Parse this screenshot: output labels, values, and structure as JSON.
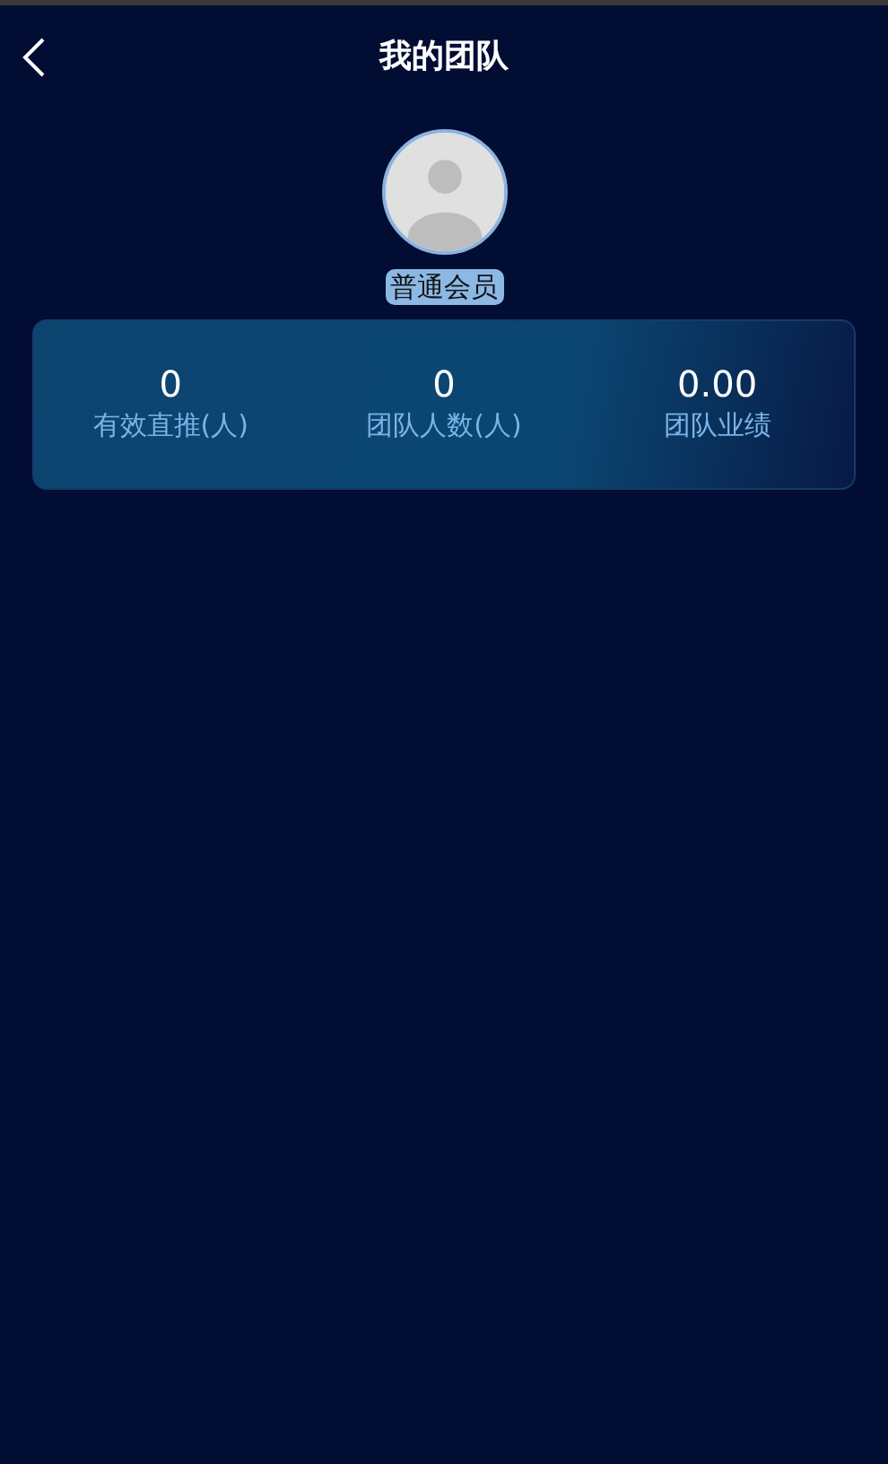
{
  "header": {
    "title": "我的团队"
  },
  "profile": {
    "level": "普通会员"
  },
  "stats": [
    {
      "value": "0",
      "label": "有效直推(人)"
    },
    {
      "value": "0",
      "label": "团队人数(人)"
    },
    {
      "value": "0.00",
      "label": "团队业绩"
    }
  ]
}
